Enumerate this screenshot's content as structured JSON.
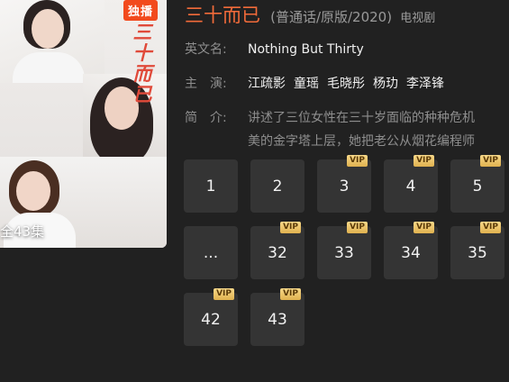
{
  "poster": {
    "badge": "独播",
    "calligraphy": "三十而已",
    "episode_total": "全43集"
  },
  "show": {
    "title": "三十而已",
    "subtitle": "(普通话/原版/2020)",
    "type": "电视剧"
  },
  "info": {
    "english_label": "英文名:",
    "english_value": "Nothing But Thirty",
    "cast_label": "主　演:",
    "cast": [
      "江疏影",
      "童瑶",
      "毛晓彤",
      "杨玏",
      "李泽锋"
    ],
    "intro_label": "简　介:",
    "intro_line1": "讲述了三位女性在三十岁面临的种种危机",
    "intro_line2": "美的金字塔上层，她把老公从烟花编程师"
  },
  "episodes": [
    {
      "label": "1",
      "vip": ""
    },
    {
      "label": "2",
      "vip": ""
    },
    {
      "label": "3",
      "vip": "VIP"
    },
    {
      "label": "4",
      "vip": "VIP"
    },
    {
      "label": "5",
      "vip": "VIP"
    },
    {
      "label": "...",
      "vip": ""
    },
    {
      "label": "32",
      "vip": "VIP"
    },
    {
      "label": "33",
      "vip": "VIP"
    },
    {
      "label": "34",
      "vip": "VIP"
    },
    {
      "label": "35",
      "vip": "VIP"
    },
    {
      "label": "42",
      "vip": "VIP"
    },
    {
      "label": "43",
      "vip": "VIP"
    }
  ],
  "colors": {
    "accent": "#f26b3a",
    "vip": "#e8bf5f",
    "tile": "#343434",
    "background": "#212121"
  }
}
